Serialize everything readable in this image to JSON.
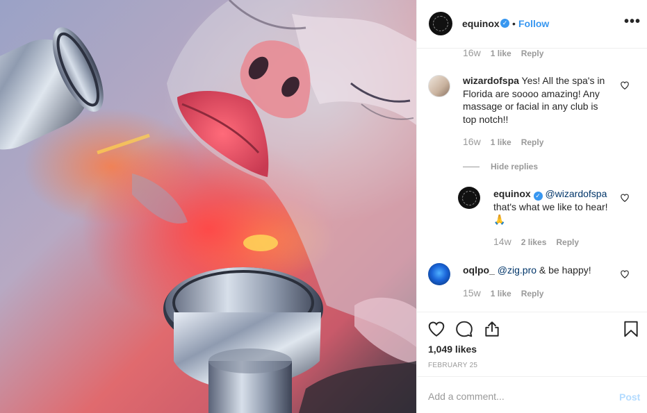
{
  "post": {
    "username": "equinox",
    "dot": "•",
    "follow_label": "Follow",
    "more_label": "•••",
    "verified_glyph": "✓"
  },
  "comments": {
    "first_meta": {
      "time": "16w",
      "likes": "1 like",
      "reply": "Reply"
    },
    "items": [
      {
        "username": "wizardofspa",
        "text": "Yes! All the spa's in Florida are soooo amazing! Any massage or facial in any club is top notch!!",
        "time": "16w",
        "likes": "1 like",
        "reply": "Reply"
      },
      {
        "username": "oqlpo_",
        "mention": "@zig.pro",
        "text": " & be happy!",
        "time": "15w",
        "likes": "1 like",
        "reply": "Reply"
      }
    ],
    "hide_replies_label": "Hide replies",
    "reply": {
      "username": "equinox",
      "mention": "@wizardofspa",
      "text": "that's what we like to hear!",
      "emoji": "🙏",
      "time": "14w",
      "likes": "2 likes",
      "reply": "Reply"
    }
  },
  "footer": {
    "likes_count": "1,049 likes",
    "date": "FEBRUARY 25",
    "comment_placeholder": "Add a comment...",
    "post_label": "Post"
  },
  "colors": {
    "accent": "#3897f0",
    "muted": "#999999",
    "text": "#262626",
    "post_disabled": "#b3dbff"
  },
  "icons": [
    "heart-icon",
    "comment-icon",
    "share-icon",
    "bookmark-icon",
    "more-icon",
    "verified-badge-icon"
  ]
}
